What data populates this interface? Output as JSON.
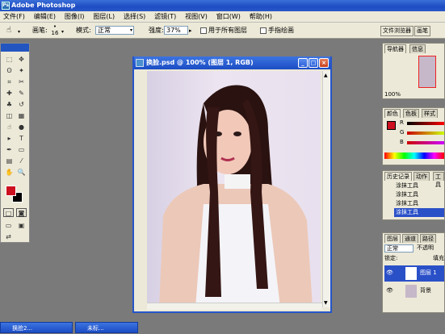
{
  "app": {
    "title": "Adobe Photoshop",
    "logo": "Ps"
  },
  "menu": [
    "文件(F)",
    "编辑(E)",
    "图像(I)",
    "图层(L)",
    "选择(S)",
    "滤镜(T)",
    "视图(V)",
    "窗口(W)",
    "帮助(H)"
  ],
  "options": {
    "brush_label": "画笔:",
    "brush_size": "16",
    "mode_label": "模式:",
    "mode_value": "正常",
    "strength_label": "强度:",
    "strength_value": "37%",
    "all_layers_label": "用于所有图层",
    "finger_label": "手指绘画",
    "browser_tab": "文件浏览器",
    "brushes_tab": "画笔"
  },
  "document": {
    "title": "换脸.psd @ 100% (图层 1, RGB)",
    "btn_min": "_",
    "btn_max": "□",
    "btn_close": "×"
  },
  "navigator": {
    "tab1": "导航器",
    "tab2": "信息",
    "zoom": "100%"
  },
  "color_panel": {
    "tab1": "颜色",
    "tab2": "色板",
    "tab3": "样式",
    "channels": [
      "R",
      "G",
      "B"
    ],
    "fg": "#cc1020",
    "bg": "#000000"
  },
  "history": {
    "tab1": "历史记录",
    "tab2": "动作",
    "tab3": "工具",
    "items": [
      "涂抹工具",
      "涂抹工具",
      "涂抹工具",
      "涂抹工具"
    ]
  },
  "layers": {
    "tab1": "图层",
    "tab2": "通道",
    "tab3": "路径",
    "blend": "正常",
    "opacity_label": "不透明",
    "lock_label": "锁定:",
    "fill_label": "填充",
    "items": [
      "图层 1",
      "背景"
    ]
  },
  "taskbar": [
    "换脸2...",
    "未标..."
  ],
  "tools": [
    "marquee-tool",
    "move-tool",
    "lasso-tool",
    "magic-wand-tool",
    "crop-tool",
    "slice-tool",
    "healing-tool",
    "brush-tool",
    "stamp-tool",
    "history-brush-tool",
    "eraser-tool",
    "gradient-tool",
    "smudge-tool",
    "dodge-tool",
    "path-select-tool",
    "type-tool",
    "pen-tool",
    "shape-tool",
    "notes-tool",
    "eyedropper-tool",
    "hand-tool",
    "zoom-tool"
  ],
  "tool_glyphs": [
    "⬚",
    "✥",
    "ʘ",
    "✦",
    "⌗",
    "✂",
    "✚",
    "✎",
    "♣",
    "↺",
    "◫",
    "▦",
    "☝",
    "●",
    "▸",
    "T",
    "✒",
    "▭",
    "▤",
    "⁄",
    "✋",
    "🔍"
  ]
}
